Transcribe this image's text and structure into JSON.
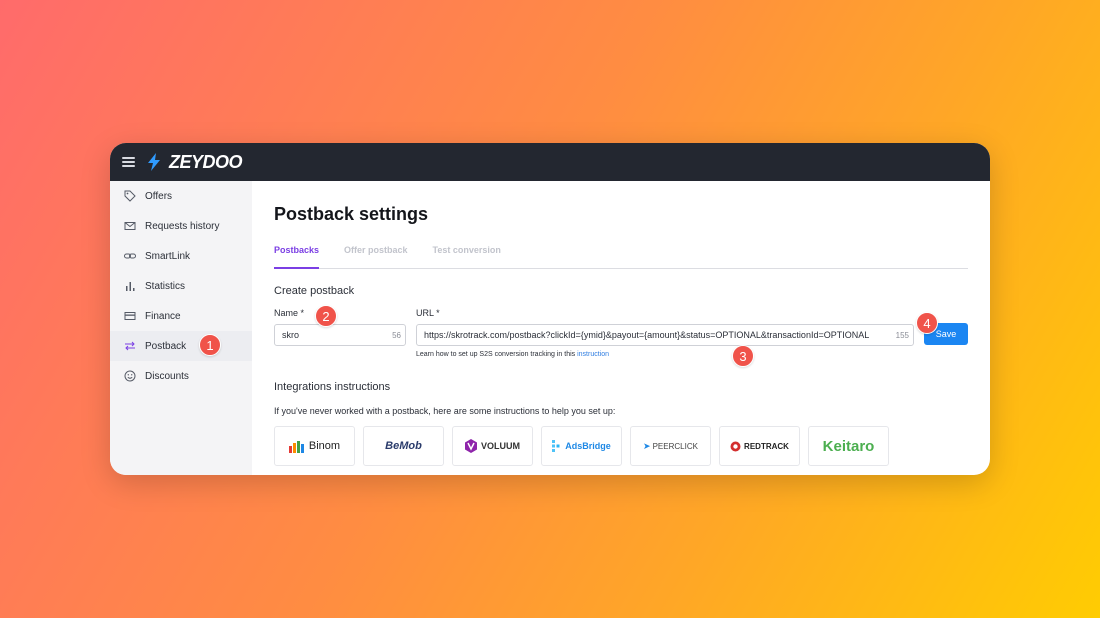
{
  "app": {
    "brand": "ZEYDOO"
  },
  "sidebar": {
    "items": [
      {
        "label": "Offers",
        "icon": "tag-icon"
      },
      {
        "label": "Requests history",
        "icon": "mail-icon"
      },
      {
        "label": "SmartLink",
        "icon": "link-icon"
      },
      {
        "label": "Statistics",
        "icon": "bar-chart-icon"
      },
      {
        "label": "Finance",
        "icon": "card-icon"
      },
      {
        "label": "Postback",
        "icon": "arrows-icon",
        "active": true
      },
      {
        "label": "Discounts",
        "icon": "smile-icon"
      }
    ]
  },
  "page": {
    "title": "Postback settings",
    "tabs": [
      {
        "label": "Postbacks",
        "active": true
      },
      {
        "label": "Offer postback"
      },
      {
        "label": "Test conversion"
      }
    ],
    "create_title": "Create postback",
    "name_label": "Name *",
    "name_value": "skro",
    "name_counter": "56",
    "url_label": "URL *",
    "url_value": "https://skrotrack.com/postback?clickId={ymid}&payout={amount}&status=OPTIONAL&transactionId=OPTIONAL",
    "url_counter": "155",
    "hint_text": "Learn how to set up S2S conversion tracking in this ",
    "hint_link": "instruction",
    "save_label": "Save",
    "integrations_title": "Integrations instructions",
    "integrations_sub": "If you've never worked with a postback, here are some instructions to help you set up:",
    "integrations": [
      "Binom",
      "BeMob",
      "VOLUUM",
      "AdsBridge",
      "PEERCLICK",
      "REDTRACK",
      "Keitaro"
    ]
  },
  "markers": [
    "1",
    "2",
    "3",
    "4"
  ],
  "colors": {
    "accent": "#7b3fe4",
    "primary": "#1b86f2",
    "marker": "#f0534a"
  }
}
